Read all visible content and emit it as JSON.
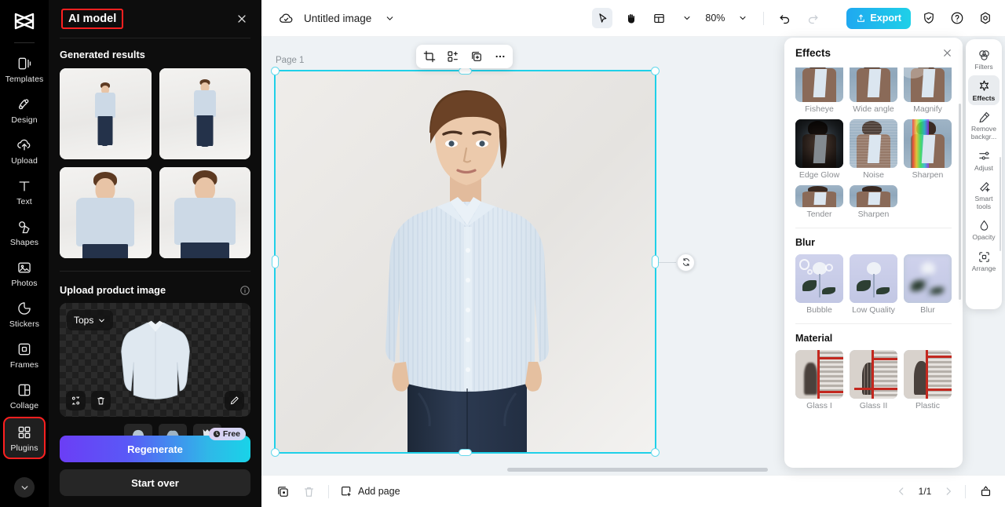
{
  "left_rail": {
    "logo_name": "capcut-logo",
    "items": [
      {
        "label": "Templates",
        "icon": "templates-icon"
      },
      {
        "label": "Design",
        "icon": "design-icon"
      },
      {
        "label": "Upload",
        "icon": "upload-icon"
      },
      {
        "label": "Text",
        "icon": "text-icon"
      },
      {
        "label": "Shapes",
        "icon": "shapes-icon"
      },
      {
        "label": "Photos",
        "icon": "photos-icon"
      },
      {
        "label": "Stickers",
        "icon": "stickers-icon"
      },
      {
        "label": "Frames",
        "icon": "frames-icon"
      },
      {
        "label": "Collage",
        "icon": "collage-icon"
      },
      {
        "label": "Plugins",
        "icon": "plugins-icon"
      }
    ],
    "expand_icon": "chevron-down-icon"
  },
  "panel": {
    "title": "AI model",
    "close_icon": "close-icon",
    "generated_results_title": "Generated results",
    "results": [
      {
        "name": "result-1"
      },
      {
        "name": "result-2"
      },
      {
        "name": "result-3"
      },
      {
        "name": "result-4"
      }
    ],
    "upload_title": "Upload product image",
    "info_icon": "info-icon",
    "category_value": "Tops",
    "category_caret": "chevron-down-icon",
    "upload_buttons": [
      {
        "name": "replace-icon"
      },
      {
        "name": "delete-icon"
      },
      {
        "name": "edit-icon"
      }
    ],
    "garment_types_label": "",
    "garment_thumbs": [
      "garment-1",
      "garment-2",
      "garment-3"
    ],
    "free_badge": "Free",
    "free_badge_icon": "clock-icon",
    "regenerate_label": "Regenerate",
    "start_over_label": "Start over"
  },
  "topbar": {
    "cloud_icon": "cloud-save-icon",
    "doc_title": "Untitled image",
    "title_caret": "chevron-down-icon",
    "tools": [
      {
        "name": "select-tool",
        "icon": "cursor-icon",
        "active": true
      },
      {
        "name": "hand-tool",
        "icon": "hand-icon",
        "active": false
      },
      {
        "name": "layout-tool",
        "icon": "layout-icon",
        "active": false
      }
    ],
    "layout_caret": "chevron-down-icon",
    "zoom_value": "80%",
    "zoom_caret": "chevron-down-icon",
    "undo_icon": "undo-icon",
    "redo_icon": "redo-icon",
    "export_label": "Export",
    "export_icon": "export-icon",
    "shield_icon": "shield-check-icon",
    "help_icon": "help-icon",
    "settings_icon": "settings-icon"
  },
  "canvas": {
    "page_label": "Page 1",
    "float_tools": [
      {
        "name": "crop-icon"
      },
      {
        "name": "arrange-icon"
      },
      {
        "name": "duplicate-icon"
      },
      {
        "name": "more-icon"
      }
    ],
    "rotate_icon": "rotate-icon"
  },
  "bottombar": {
    "duplicate_page_icon": "duplicate-page-icon",
    "delete_page_icon": "delete-page-icon",
    "add_page_label": "Add page",
    "add_page_icon": "add-page-icon",
    "prev_icon": "chevron-left-icon",
    "page_count": "1/1",
    "next_icon": "chevron-right-icon",
    "timeline_icon": "timeline-icon"
  },
  "effects_panel": {
    "title": "Effects",
    "close_icon": "close-icon",
    "sections": [
      {
        "title": "",
        "items": [
          {
            "label": "Fisheye",
            "style": "person"
          },
          {
            "label": "Wide angle",
            "style": "person"
          },
          {
            "label": "Magnify",
            "style": "person"
          },
          {
            "label": "Edge Glow",
            "style": "person-dark"
          },
          {
            "label": "Noise",
            "style": "person-noise"
          },
          {
            "label": "Sharpen",
            "style": "person-rgb"
          },
          {
            "label": "Tender",
            "style": "person"
          },
          {
            "label": "Sharpen",
            "style": "person"
          }
        ]
      },
      {
        "title": "Blur",
        "items": [
          {
            "label": "Bubble",
            "style": "rose-bubble"
          },
          {
            "label": "Low Quality",
            "style": "rose"
          },
          {
            "label": "Blur",
            "style": "rose-blur"
          }
        ]
      },
      {
        "title": "Material",
        "items": [
          {
            "label": "Glass I",
            "style": "material"
          },
          {
            "label": "Glass II",
            "style": "material"
          },
          {
            "label": "Plastic",
            "style": "material"
          }
        ]
      }
    ]
  },
  "right_rail": {
    "items": [
      {
        "label": "Filters",
        "icon": "filters-icon",
        "active": false
      },
      {
        "label": "Effects",
        "icon": "effects-icon",
        "active": true
      },
      {
        "label": "Remove backgr...",
        "icon": "remove-bg-icon",
        "active": false
      },
      {
        "label": "Adjust",
        "icon": "adjust-icon",
        "active": false
      },
      {
        "label": "Smart tools",
        "icon": "smart-tools-icon",
        "active": false
      },
      {
        "label": "Opacity",
        "icon": "opacity-icon",
        "active": false
      },
      {
        "label": "Arrange",
        "icon": "arrange-icon",
        "active": false
      }
    ]
  },
  "colors": {
    "accent_cyan": "#1fd0e8",
    "highlight_red": "#ff2020",
    "panel_bg": "#0d0d0d",
    "canvas_bg": "#eef2f5"
  }
}
